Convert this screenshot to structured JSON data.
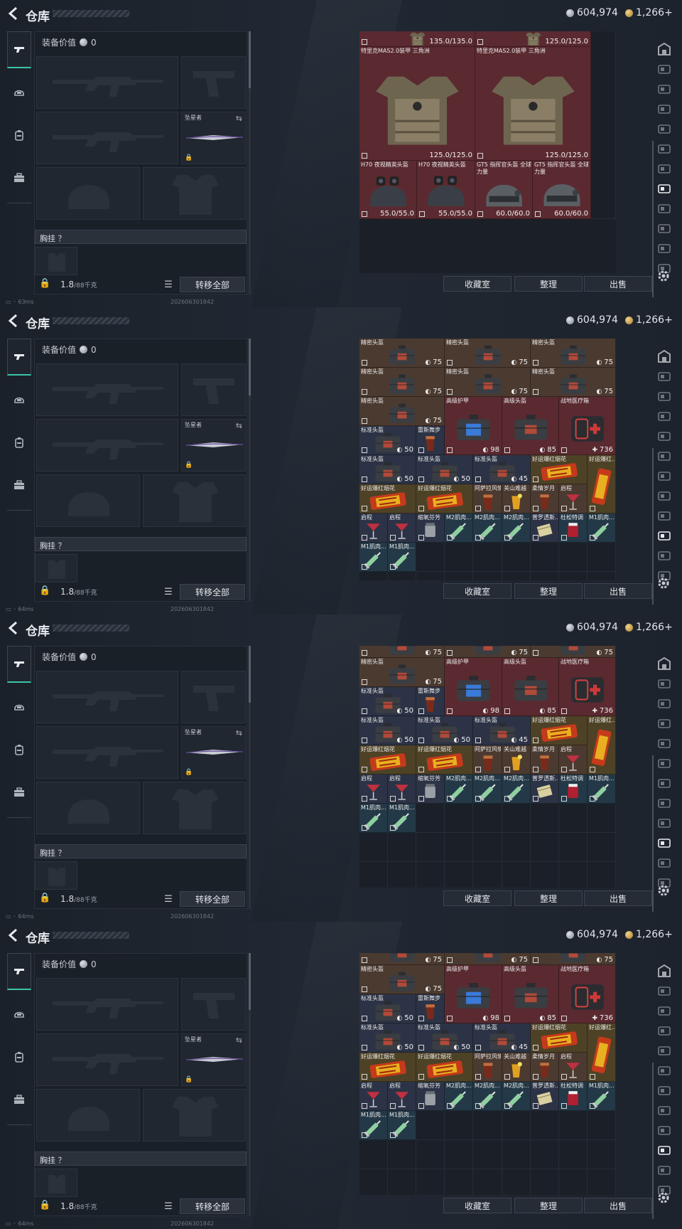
{
  "header": {
    "title": "仓库",
    "currency_silver": "604,974",
    "currency_gold": "1,266+"
  },
  "equipment": {
    "value_label": "装备价值",
    "value": "0",
    "knife_label": "坠星者",
    "vest_label": "胸挂 ？",
    "weight_value": "1.8",
    "weight_max": "/88千克",
    "transfer_label": "转移全部"
  },
  "actions": {
    "collection": "收藏室",
    "sort": "整理",
    "sell": "出售"
  },
  "icons": {
    "back": "back-arrow-icon",
    "gun_tab": "gun-icon",
    "helmet_tab": "helmet-icon",
    "bag_tab": "backpack-icon",
    "case_tab": "case-icon",
    "settings": "gear-icon",
    "lock": "lock-icon",
    "list": "list-icon"
  },
  "frames": [
    {
      "status_ping": "63ms",
      "status_time": "202606301842",
      "items": [
        {
          "name": "",
          "value": "135.0/135.0",
          "color": "red"
        },
        {
          "name": "",
          "value": "125.0/125.0",
          "color": "red"
        },
        {
          "name": "特里克MAS2.0装甲 三角洲",
          "value": "125.0/125.0",
          "color": "red"
        },
        {
          "name": "特里克MAS2.0装甲 三角洲",
          "value": "125.0/125.0",
          "color": "red"
        },
        {
          "name": "H70 夜视精英头盔",
          "value": "55.0/55.0",
          "color": "red"
        },
        {
          "name": "H70 夜视精英头盔",
          "value": "55.0/55.0",
          "color": "red"
        },
        {
          "name": "GT5 指挥官头盔 全球力量",
          "value": "60.0/60.0",
          "color": "red"
        },
        {
          "name": "GT5 指挥官头盔 全球力量",
          "value": "60.0/60.0",
          "color": "red"
        }
      ]
    },
    {
      "status_ping": "64ms",
      "status_time": "202606301842",
      "items": [
        {
          "name": "精密头盔",
          "value": "75"
        },
        {
          "name": "精密头盔",
          "value": "75"
        },
        {
          "name": "精密头盔",
          "value": "75"
        },
        {
          "name": "精密头盔",
          "value": "75"
        },
        {
          "name": "精密头盔",
          "value": "75"
        },
        {
          "name": "精密头盔",
          "value": "75"
        },
        {
          "name": "精密头盔",
          "value": "75"
        },
        {
          "name": "高级护甲",
          "value": "98"
        },
        {
          "name": "高级头盔",
          "value": "85"
        },
        {
          "name": "战地医疗箱",
          "value": "736"
        },
        {
          "name": "标准头盔",
          "value": "50"
        },
        {
          "name": "雷斯舞步",
          "value": ""
        },
        {
          "name": "标准头盔",
          "value": "50"
        },
        {
          "name": "标准头盔",
          "value": "50"
        },
        {
          "name": "标准头盔",
          "value": "45"
        },
        {
          "name": "好运爆红烟花",
          "value": ""
        },
        {
          "name": "好运爆红...",
          "value": ""
        },
        {
          "name": "好运爆红烟花",
          "value": ""
        },
        {
          "name": "好运爆红烟花",
          "value": ""
        },
        {
          "name": "阿萨拉风情",
          "value": ""
        },
        {
          "name": "关山难越",
          "value": ""
        },
        {
          "name": "柔情岁月",
          "value": ""
        },
        {
          "name": "启程",
          "value": ""
        },
        {
          "name": "启程",
          "value": ""
        },
        {
          "name": "启程",
          "value": ""
        },
        {
          "name": "缩氧芬芳",
          "value": ""
        },
        {
          "name": "M2肌肉...",
          "value": ""
        },
        {
          "name": "M2肌肉...",
          "value": ""
        },
        {
          "name": "M2肌肉...",
          "value": ""
        },
        {
          "name": "普罗透斯...",
          "value": ""
        },
        {
          "name": "杜松特调",
          "value": ""
        },
        {
          "name": "M1肌肉...",
          "value": ""
        },
        {
          "name": "M1肌肉...",
          "value": ""
        },
        {
          "name": "M1肌肉...",
          "value": ""
        }
      ]
    },
    {
      "status_ping": "64ms",
      "status_time": "202606301842",
      "items": [
        {
          "name": "",
          "value": "75"
        },
        {
          "name": "",
          "value": "75"
        },
        {
          "name": "",
          "value": "75"
        },
        {
          "name": "精密头盔",
          "value": "75"
        },
        {
          "name": "高级护甲",
          "value": "98"
        },
        {
          "name": "高级头盔",
          "value": "85"
        },
        {
          "name": "战地医疗箱",
          "value": "736"
        },
        {
          "name": "标准头盔",
          "value": "50"
        },
        {
          "name": "雷斯舞步",
          "value": ""
        },
        {
          "name": "标准头盔",
          "value": "50"
        },
        {
          "name": "标准头盔",
          "value": "50"
        },
        {
          "name": "标准头盔",
          "value": "45"
        },
        {
          "name": "好运爆红烟花",
          "value": ""
        },
        {
          "name": "好运爆红...",
          "value": ""
        },
        {
          "name": "好运爆红烟花",
          "value": ""
        },
        {
          "name": "好运爆红烟花",
          "value": ""
        },
        {
          "name": "阿萨拉风情",
          "value": ""
        },
        {
          "name": "关山难越",
          "value": ""
        },
        {
          "name": "柔情岁月",
          "value": ""
        },
        {
          "name": "启程",
          "value": ""
        },
        {
          "name": "启程",
          "value": ""
        },
        {
          "name": "启程",
          "value": ""
        },
        {
          "name": "缩氧芬芳",
          "value": ""
        },
        {
          "name": "M2肌肉...",
          "value": ""
        },
        {
          "name": "M2肌肉...",
          "value": ""
        },
        {
          "name": "M2肌肉...",
          "value": ""
        },
        {
          "name": "普罗透斯...",
          "value": ""
        },
        {
          "name": "杜松特调",
          "value": ""
        },
        {
          "name": "M1肌肉...",
          "value": ""
        },
        {
          "name": "M1肌肉...",
          "value": ""
        },
        {
          "name": "M1肌肉...",
          "value": ""
        }
      ]
    },
    {
      "status_ping": "64ms",
      "status_time": "202606301842",
      "items": [
        {
          "name": "",
          "value": "75"
        },
        {
          "name": "",
          "value": "75"
        },
        {
          "name": "",
          "value": "75"
        },
        {
          "name": "精密头盔",
          "value": "75"
        },
        {
          "name": "高级护甲",
          "value": "98"
        },
        {
          "name": "高级头盔",
          "value": "85"
        },
        {
          "name": "战地医疗箱",
          "value": "736"
        },
        {
          "name": "标准头盔",
          "value": "50"
        },
        {
          "name": "雷斯舞步",
          "value": ""
        },
        {
          "name": "标准头盔",
          "value": "50"
        },
        {
          "name": "标准头盔",
          "value": "50"
        },
        {
          "name": "标准头盔",
          "value": "45"
        },
        {
          "name": "好运爆红烟花",
          "value": ""
        },
        {
          "name": "好运爆红...",
          "value": ""
        },
        {
          "name": "好运爆红烟花",
          "value": ""
        },
        {
          "name": "好运爆红烟花",
          "value": ""
        },
        {
          "name": "阿萨拉风情",
          "value": ""
        },
        {
          "name": "关山难越",
          "value": ""
        },
        {
          "name": "柔情岁月",
          "value": ""
        },
        {
          "name": "启程",
          "value": ""
        },
        {
          "name": "启程",
          "value": ""
        },
        {
          "name": "启程",
          "value": ""
        },
        {
          "name": "缩氧芬芳",
          "value": ""
        },
        {
          "name": "M2肌肉...",
          "value": ""
        },
        {
          "name": "M2肌肉...",
          "value": ""
        },
        {
          "name": "M2肌肉...",
          "value": ""
        },
        {
          "name": "普罗透斯...",
          "value": ""
        },
        {
          "name": "杜松特调",
          "value": ""
        },
        {
          "name": "M1肌肉...",
          "value": ""
        },
        {
          "name": "M1肌肉...",
          "value": ""
        },
        {
          "name": "M1肌肉...",
          "value": ""
        }
      ]
    }
  ]
}
